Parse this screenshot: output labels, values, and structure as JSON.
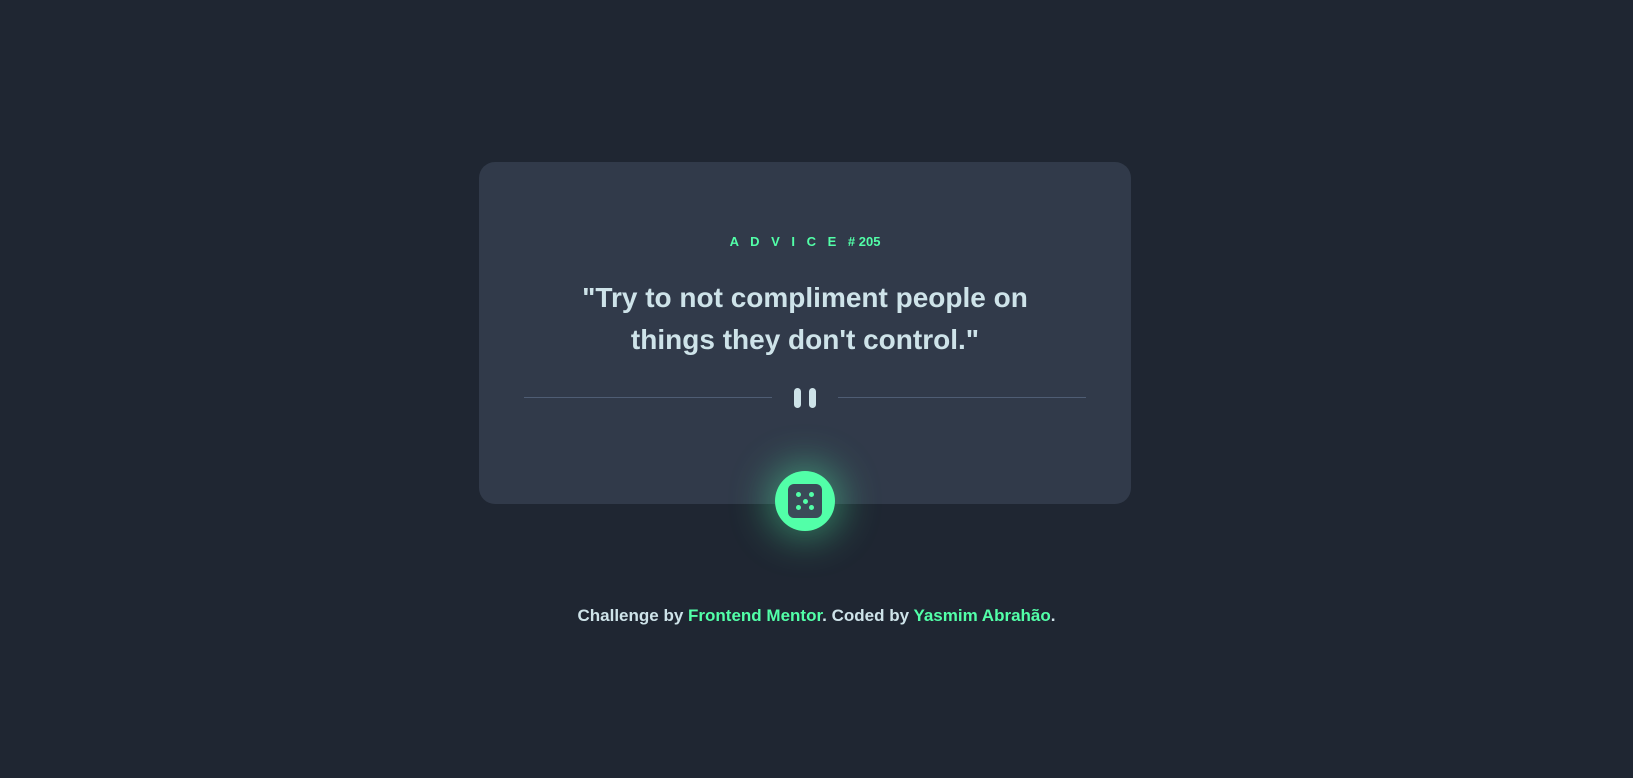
{
  "card": {
    "label_prefix": "A D V I C E",
    "label_number": "# 205",
    "quote": "\"Try to not compliment people on things they don't control.\""
  },
  "divider": {
    "icon": "pause-icon"
  },
  "dice_button": {
    "icon": "dice-icon"
  },
  "footer": {
    "text_1": "Challenge by ",
    "link_1": "Frontend Mentor",
    "text_2": ". Coded by ",
    "link_2": "Yasmim Abrahão",
    "text_3": "."
  },
  "colors": {
    "background": "#1f2632",
    "card": "#313a4a",
    "accent": "#52ffa8",
    "text": "#cee3e9",
    "divider": "#4f5d74"
  }
}
